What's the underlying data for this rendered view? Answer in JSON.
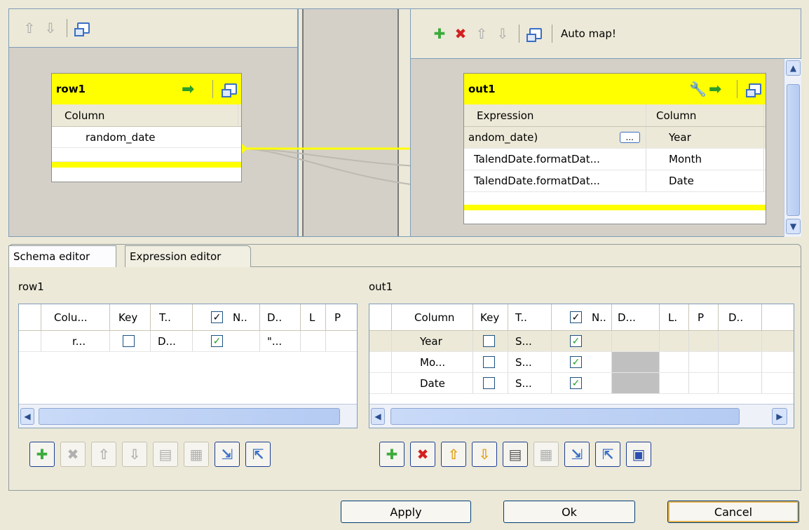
{
  "input_panel": {
    "table_name": "row1",
    "column_header": "Column",
    "rows": [
      "random_date"
    ]
  },
  "output_panel": {
    "toolbar": {
      "auto_map_label": "Auto map!"
    },
    "table_name": "out1",
    "headers": {
      "expression": "Expression",
      "column": "Column"
    },
    "rows": [
      {
        "expression": "andom_date)",
        "ellipsis": "...",
        "column": "Year"
      },
      {
        "expression": "TalendDate.formatDat...",
        "column": "Month"
      },
      {
        "expression": "TalendDate.formatDat...",
        "column": "Date"
      }
    ]
  },
  "tabs": [
    {
      "label": "Schema editor"
    },
    {
      "label": "Expression editor"
    }
  ],
  "schema": {
    "left": {
      "title": "row1",
      "headers": [
        "Colu...",
        "Key",
        "T..",
        "N..",
        "D..",
        "L",
        "P"
      ],
      "rows": [
        {
          "column": "r...",
          "type": "D...",
          "default": "\"..."
        }
      ]
    },
    "right": {
      "title": "out1",
      "headers": [
        "Column",
        "Key",
        "T..",
        "N..",
        "D...",
        "L.",
        "P",
        "D.."
      ],
      "rows": [
        {
          "column": "Year",
          "type": "S..."
        },
        {
          "column": "Mo...",
          "type": "S..."
        },
        {
          "column": "Date",
          "type": "S..."
        }
      ]
    }
  },
  "buttons": {
    "apply": "Apply",
    "ok": "Ok",
    "cancel": "Cancel"
  },
  "colors": {
    "table_header": "#ffff00",
    "link": "#ffff00",
    "accent_blue": "#3a6fc6"
  }
}
